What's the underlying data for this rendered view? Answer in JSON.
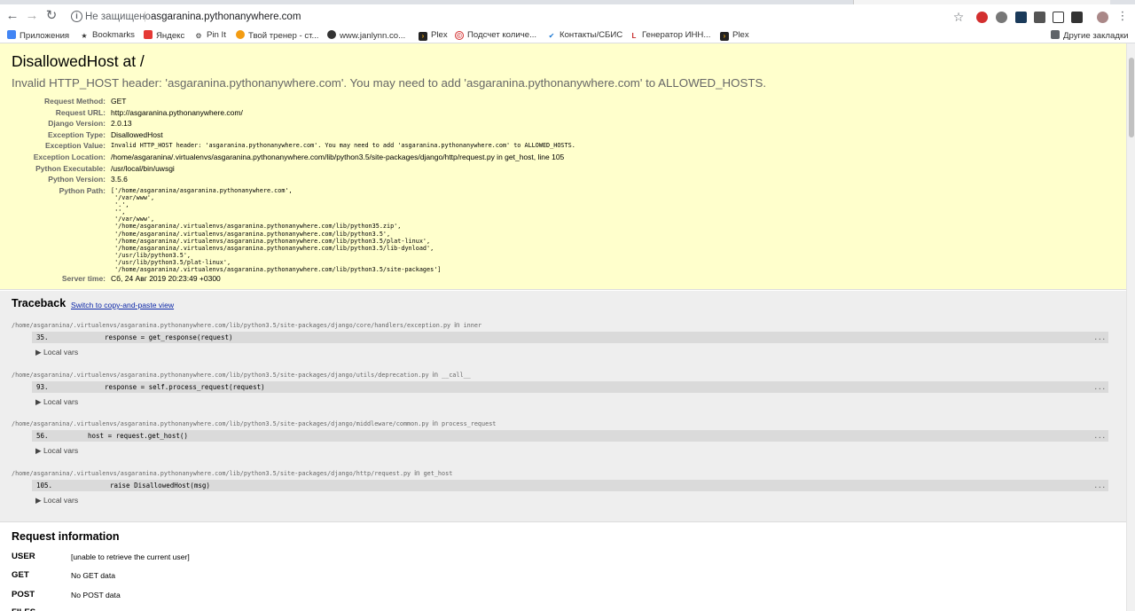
{
  "browser": {
    "insecure_label": "Не защищено",
    "separator": "|",
    "url": "asgaranina.pythonanywhere.com",
    "back_glyph": "←",
    "forward_glyph": "→",
    "reload_glyph": "↻",
    "star_glyph": "☆",
    "info_glyph": "i"
  },
  "bookmarks": {
    "items": [
      "Приложения",
      "Bookmarks",
      "Яндекс",
      "Pin It",
      "Твой тренер - ст...",
      "www.janlynn.co...",
      "Plex",
      "Подсчет количе...",
      "Контакты/СБИС",
      "Генератор ИНН...",
      "Plex"
    ],
    "other": "Другие закладки"
  },
  "error": {
    "title": "DisallowedHost at /",
    "message": "Invalid HTTP_HOST header: 'asgaranina.pythonanywhere.com'. You may need to add 'asgaranina.pythonanywhere.com' to ALLOWED_HOSTS.",
    "meta": [
      {
        "key": "Request Method:",
        "value": "GET"
      },
      {
        "key": "Request URL:",
        "value": "http://asgaranina.pythonanywhere.com/"
      },
      {
        "key": "Django Version:",
        "value": "2.0.13"
      },
      {
        "key": "Exception Type:",
        "value": "DisallowedHost"
      },
      {
        "key": "Exception Value:",
        "value": "Invalid HTTP_HOST header: 'asgaranina.pythonanywhere.com'. You may need to add 'asgaranina.pythonanywhere.com' to ALLOWED_HOSTS."
      },
      {
        "key": "Exception Location:",
        "value": "/home/asgaranina/.virtualenvs/asgaranina.pythonanywhere.com/lib/python3.5/site-packages/django/http/request.py in get_host, line 105"
      },
      {
        "key": "Python Executable:",
        "value": "/usr/local/bin/uwsgi"
      },
      {
        "key": "Python Version:",
        "value": "3.5.6"
      },
      {
        "key": "Python Path:",
        "value": "['/home/asgaranina/asgaranina.pythonanywhere.com',\n '/var/www',\n '.',\n '',\n '/var/www',\n '/home/asgaranina/.virtualenvs/asgaranina.pythonanywhere.com/lib/python35.zip',\n '/home/asgaranina/.virtualenvs/asgaranina.pythonanywhere.com/lib/python3.5',\n '/home/asgaranina/.virtualenvs/asgaranina.pythonanywhere.com/lib/python3.5/plat-linux',\n '/home/asgaranina/.virtualenvs/asgaranina.pythonanywhere.com/lib/python3.5/lib-dynload',\n '/usr/lib/python3.5',\n '/usr/lib/python3.5/plat-linux',\n '/home/asgaranina/.virtualenvs/asgaranina.pythonanywhere.com/lib/python3.5/site-packages']"
      },
      {
        "key": "Server time:",
        "value": "Сб, 24 Авг 2019 20:23:49 +0300"
      }
    ]
  },
  "traceback": {
    "title": "Traceback",
    "switch_label": "Switch to copy-and-paste view",
    "in_label": "in",
    "more": "...",
    "local_vars": "▶ Local vars",
    "frames": [
      {
        "file": "/home/asgaranina/.virtualenvs/asgaranina.pythonanywhere.com/lib/python3.5/site-packages/django/core/handlers/exception.py",
        "func": "inner",
        "line": "35.",
        "code": "response = get_response(request)"
      },
      {
        "file": "/home/asgaranina/.virtualenvs/asgaranina.pythonanywhere.com/lib/python3.5/site-packages/django/utils/deprecation.py",
        "func": "__call__",
        "line": "93.",
        "code": "response = self.process_request(request)"
      },
      {
        "file": "/home/asgaranina/.virtualenvs/asgaranina.pythonanywhere.com/lib/python3.5/site-packages/django/middleware/common.py",
        "func": "process_request",
        "line": "56.",
        "code": "host = request.get_host()"
      },
      {
        "file": "/home/asgaranina/.virtualenvs/asgaranina.pythonanywhere.com/lib/python3.5/site-packages/django/http/request.py",
        "func": "get_host",
        "line": "105.",
        "code": "raise DisallowedHost(msg)"
      }
    ]
  },
  "request_info": {
    "title": "Request information",
    "rows": [
      {
        "key": "USER",
        "value": "[unable to retrieve the current user]"
      },
      {
        "key": "GET",
        "value": "No GET data"
      },
      {
        "key": "POST",
        "value": "No POST data"
      },
      {
        "key": "FILES",
        "value": ""
      }
    ]
  }
}
